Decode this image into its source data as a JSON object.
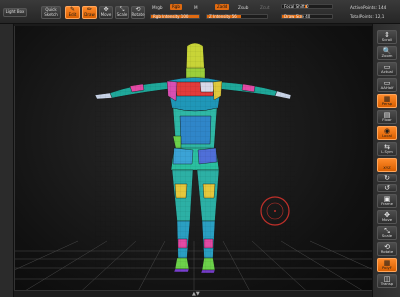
{
  "toolbar": {
    "lightbox": "Light Box",
    "quicksketch_line1": "Quick",
    "quicksketch_line2": "Sketch",
    "edit": "Edit",
    "draw": "Draw",
    "move": "Move",
    "scale": "Scale",
    "rotate": "Rotate",
    "mrgb": "Mrgb",
    "rgb": "Rgb",
    "m": "M",
    "zadd": "Zadd",
    "zsub": "Zsub",
    "zcut": "Zcut",
    "rgb_intensity": "Rgb Intensity 100",
    "z_intensity": "Z Intensity 56",
    "focal_shift": "Focal Shift 0",
    "draw_size": "Draw Size 40",
    "active_points": "ActivePoints: 144",
    "total_points": "TotalPoints: 12,1"
  },
  "sliders": {
    "rgb_intensity": 100,
    "z_intensity": 56,
    "focal_shift": 50,
    "draw_size": 40
  },
  "shelf": [
    {
      "label": "Scroll",
      "icon": "⇕",
      "active": false
    },
    {
      "label": "Zoom",
      "icon": "🔍",
      "active": false
    },
    {
      "label": "Actual",
      "icon": "▭",
      "active": false
    },
    {
      "label": "AAHalf",
      "icon": "▭",
      "active": false
    },
    {
      "label": "Persp",
      "icon": "▦",
      "active": true
    },
    {
      "label": "Floor",
      "icon": "▤",
      "active": false
    },
    {
      "label": "Local",
      "icon": "◉",
      "active": true
    },
    {
      "label": "L.Sym",
      "icon": "⇆",
      "active": false
    },
    {
      "label": "XYZ",
      "icon": "",
      "active": true
    },
    {
      "label": "",
      "icon": "↻",
      "active": false
    },
    {
      "label": "",
      "icon": "↺",
      "active": false
    },
    {
      "label": "Frame",
      "icon": "▣",
      "active": false
    },
    {
      "label": "Move",
      "icon": "✥",
      "active": false
    },
    {
      "label": "Scale",
      "icon": "⤡",
      "active": false
    },
    {
      "label": "Rotate",
      "icon": "⟲",
      "active": false
    },
    {
      "label": "PolyF",
      "icon": "▦",
      "active": true
    },
    {
      "label": "Transp",
      "icon": "◫",
      "active": false
    }
  ],
  "colors": {
    "accent": "#e06a10",
    "background": "#1b1b1b"
  },
  "icons": {
    "brush_cursor": "brush-cursor-ring",
    "axis_gizmo": "axis-gizmo"
  }
}
